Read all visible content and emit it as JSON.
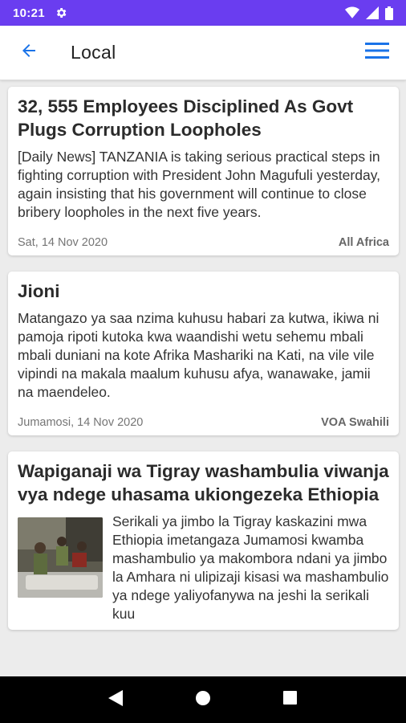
{
  "status_bar": {
    "time": "10:21"
  },
  "app_bar": {
    "title": "Local"
  },
  "articles": [
    {
      "title": "32, 555 Employees Disciplined As Govt Plugs Corruption Loopholes",
      "body": "[Daily News] TANZANIA is taking serious practical steps in fighting corruption with President John Magufuli yesterday, again insisting that his government will continue to close bribery loopholes in the next five years.",
      "date": "Sat, 14 Nov 2020",
      "source": "All Africa"
    },
    {
      "title": "Jioni",
      "body": "Matangazo ya saa nzima kuhusu habari za kutwa, ikiwa ni pamoja ripoti kutoka kwa waandishi wetu sehemu mbali mbali duniani na kote Afrika Mashariki na Kati, na vile vile vipindi na makala maalum kuhusu afya, wanawake, jamii na maendeleo.",
      "date": "Jumamosi, 14 Nov 2020",
      "source": "VOA Swahili"
    },
    {
      "title": "Wapiganaji wa Tigray washambulia viwanja vya ndege uhasama ukiongezeka Ethiopia",
      "body": "Serikali ya jimbo la Tigray kaskazini mwa Ethiopia imetangaza Jumamosi kwamba mashambulio ya makombora ndani ya jimbo la Amhara ni ulipizaji kisasi wa mashambulio ya ndege yaliyofanywa na jeshi la serikali kuu"
    }
  ],
  "icons": {
    "settings": "gear-icon",
    "wifi": "wifi-icon",
    "signal": "signal-icon",
    "battery": "battery-icon",
    "back": "arrow-left-icon",
    "menu": "hamburger-menu-icon",
    "nav_back": "triangle-back-icon",
    "nav_home": "circle-home-icon",
    "nav_recents": "square-recents-icon"
  },
  "colors": {
    "status_bar": "#6a3df0",
    "accent": "#1a73e8",
    "title_text": "#2b2b2b"
  }
}
